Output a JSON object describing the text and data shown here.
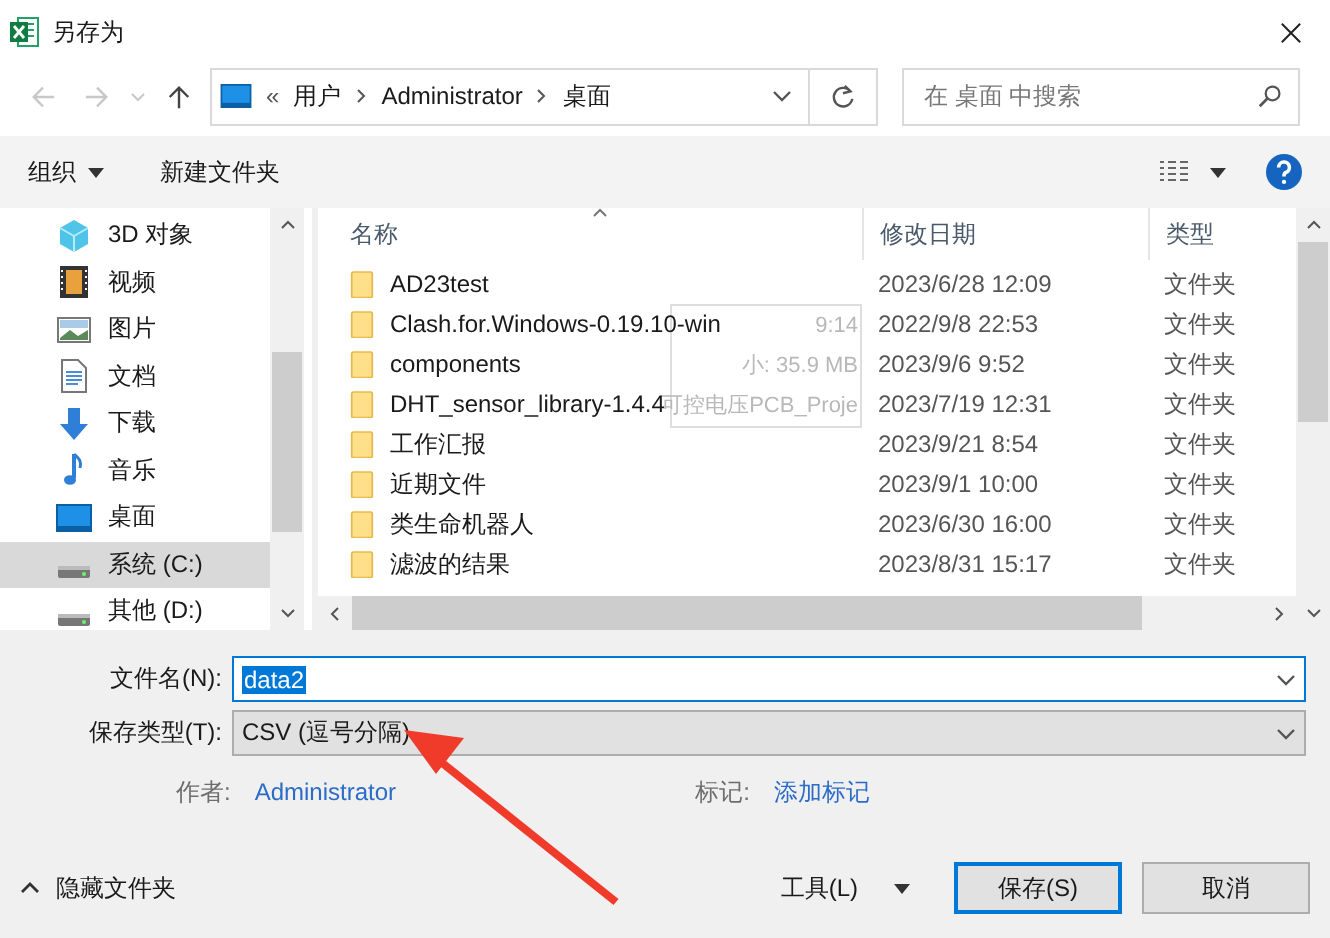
{
  "window": {
    "title": "另存为"
  },
  "address": {
    "overflow": "«",
    "segments": [
      "用户",
      "Administrator",
      "桌面"
    ]
  },
  "search": {
    "placeholder": "在 桌面 中搜索"
  },
  "toolbar": {
    "organize": "组织",
    "new_folder": "新建文件夹"
  },
  "sidebar": {
    "items": [
      {
        "label": "3D 对象",
        "kind": "cube",
        "selected": false
      },
      {
        "label": "视频",
        "kind": "film",
        "selected": false
      },
      {
        "label": "图片",
        "kind": "picture",
        "selected": false
      },
      {
        "label": "文档",
        "kind": "document",
        "selected": false
      },
      {
        "label": "下载",
        "kind": "download",
        "selected": false
      },
      {
        "label": "音乐",
        "kind": "music",
        "selected": false
      },
      {
        "label": "桌面",
        "kind": "desktop",
        "selected": false
      },
      {
        "label": "系统 (C:)",
        "kind": "drive",
        "selected": true
      },
      {
        "label": "其他 (D:)",
        "kind": "drive",
        "selected": false
      }
    ]
  },
  "file_list": {
    "columns": [
      "名称",
      "修改日期",
      "类型"
    ],
    "rows": [
      {
        "name": "AD23test",
        "date": "2023/6/28 12:09",
        "type": "文件夹"
      },
      {
        "name": "Clash.for.Windows-0.19.10-win",
        "date": "2022/9/8 22:53",
        "type": "文件夹"
      },
      {
        "name": "components",
        "date": "2023/9/6 9:52",
        "type": "文件夹"
      },
      {
        "name": "DHT_sensor_library-1.4.4",
        "date": "2023/7/19 12:31",
        "type": "文件夹"
      },
      {
        "name": "工作汇报",
        "date": "2023/9/21 8:54",
        "type": "文件夹"
      },
      {
        "name": "近期文件",
        "date": "2023/9/1 10:00",
        "type": "文件夹"
      },
      {
        "name": "类生命机器人",
        "date": "2023/6/30 16:00",
        "type": "文件夹"
      },
      {
        "name": "滤波的结果",
        "date": "2023/8/31 15:17",
        "type": "文件夹"
      }
    ]
  },
  "tooltip": {
    "lines": [
      "9:14",
      "小: 35.9 MB",
      "可控电压PCB_Proje"
    ]
  },
  "form": {
    "filename_label": "文件名(N):",
    "filename": "data2",
    "filetype_label": "保存类型(T):",
    "filetype": "CSV (逗号分隔)",
    "author_label": "作者:",
    "author": "Administrator",
    "tags_label": "标记:",
    "tags": "添加标记"
  },
  "footer": {
    "hide_folders": "隐藏文件夹",
    "tools": "工具(L)",
    "save": "保存(S)",
    "cancel": "取消"
  }
}
